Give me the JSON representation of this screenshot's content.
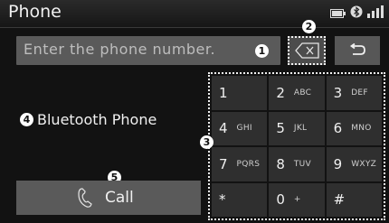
{
  "window": {
    "title": "Phone"
  },
  "input": {
    "placeholder": "Enter the phone number."
  },
  "side": {
    "bluetooth_label": "Bluetooth Phone"
  },
  "call": {
    "label": "Call"
  },
  "markers": [
    "1",
    "2",
    "3",
    "4",
    "5"
  ],
  "keypad": [
    {
      "digit": "1",
      "letters": ""
    },
    {
      "digit": "2",
      "letters": "ABC"
    },
    {
      "digit": "3",
      "letters": "DEF"
    },
    {
      "digit": "4",
      "letters": "GHI"
    },
    {
      "digit": "5",
      "letters": "JKL"
    },
    {
      "digit": "6",
      "letters": "MNO"
    },
    {
      "digit": "7",
      "letters": "PQRS"
    },
    {
      "digit": "8",
      "letters": "TUV"
    },
    {
      "digit": "9",
      "letters": "WXYZ"
    },
    {
      "digit": "*",
      "letters": ""
    },
    {
      "digit": "0",
      "letters": "+"
    },
    {
      "digit": "#",
      "letters": ""
    }
  ],
  "icons": {
    "delete": "backspace-icon",
    "back": "return-arrow-icon",
    "call": "phone-handset-icon",
    "status": [
      "battery-icon",
      "bluetooth-icon",
      "signal-icon"
    ]
  }
}
